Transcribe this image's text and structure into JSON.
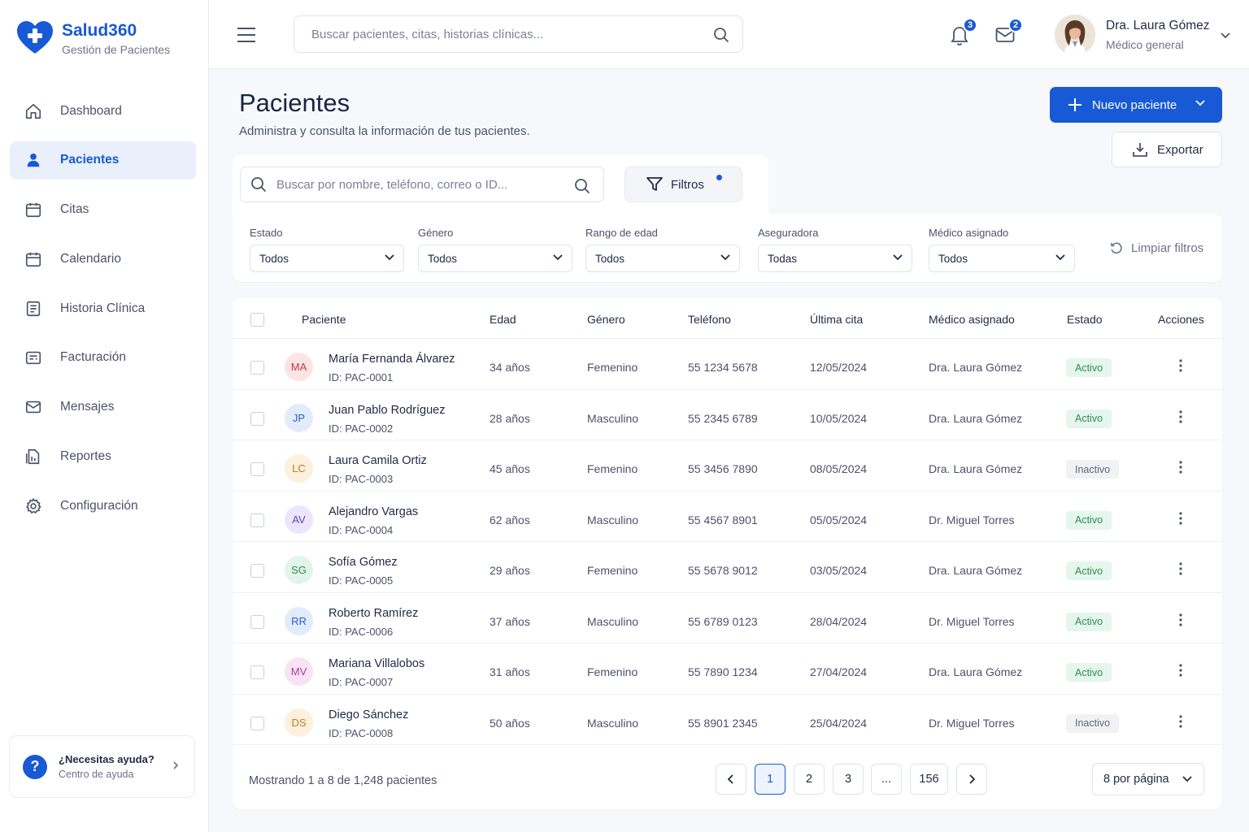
{
  "brand": {
    "name": "Salud360",
    "subtitle": "Gestión de Pacientes",
    "color": "#1859d6"
  },
  "sidebar": {
    "items": [
      {
        "label": "Dashboard",
        "icon": "home-icon",
        "active": false
      },
      {
        "label": "Pacientes",
        "icon": "user-icon",
        "active": true
      },
      {
        "label": "Citas",
        "icon": "calendar-icon",
        "active": false
      },
      {
        "label": "Calendario",
        "icon": "calendar-icon",
        "active": false
      },
      {
        "label": "Historia Clínica",
        "icon": "clipboard-icon",
        "active": false
      },
      {
        "label": "Facturación",
        "icon": "invoice-icon",
        "active": false
      },
      {
        "label": "Mensajes",
        "icon": "mail-icon",
        "active": false
      },
      {
        "label": "Reportes",
        "icon": "report-icon",
        "active": false
      },
      {
        "label": "Configuración",
        "icon": "gear-icon",
        "active": false
      }
    ],
    "help": {
      "title": "¿Necesitas ayuda?",
      "subtitle": "Centro de ayuda"
    }
  },
  "topbar": {
    "search_placeholder": "Buscar pacientes, citas, historias clínicas...",
    "notifications_count": "3",
    "messages_count": "2",
    "user": {
      "name": "Dra. Laura Gómez",
      "role": "Médico general"
    }
  },
  "page": {
    "title": "Pacientes",
    "subtitle": "Administra y consulta la información de tus pacientes.",
    "new_button": "Nuevo paciente",
    "export_button": "Exportar"
  },
  "filters": {
    "search_placeholder": "Buscar por nombre, teléfono, correo o ID...",
    "filters_button": "Filtros",
    "groups": [
      {
        "label": "Estado",
        "value": "Todos"
      },
      {
        "label": "Género",
        "value": "Todos"
      },
      {
        "label": "Rango de edad",
        "value": "Todos"
      },
      {
        "label": "Aseguradora",
        "value": "Todas"
      },
      {
        "label": "Médico asignado",
        "value": "Todos"
      }
    ],
    "clear_label": "Limpiar filtros"
  },
  "table": {
    "columns": [
      "Paciente",
      "Edad",
      "Género",
      "Teléfono",
      "Última cita",
      "Médico asignado",
      "Estado",
      "Acciones"
    ],
    "rows": [
      {
        "initials": "MA",
        "name": "María Fernanda Álvarez",
        "id": "ID: PAC-0001",
        "age": "34 años",
        "gender": "Femenino",
        "phone": "55 1234 5678",
        "last": "12/05/2024",
        "doctor": "Dra. Laura Gómez",
        "status": "Activo",
        "avatar_bg": "#fde4e4",
        "avatar_fg": "#c43b3b"
      },
      {
        "initials": "JP",
        "name": "Juan Pablo Rodríguez",
        "id": "ID: PAC-0002",
        "age": "28 años",
        "gender": "Masculino",
        "phone": "55 2345 6789",
        "last": "10/05/2024",
        "doctor": "Dra. Laura Gómez",
        "status": "Activo",
        "avatar_bg": "#e1ebfc",
        "avatar_fg": "#2a5ec4"
      },
      {
        "initials": "LC",
        "name": "Laura Camila Ortiz",
        "id": "ID: PAC-0003",
        "age": "45 años",
        "gender": "Femenino",
        "phone": "55 3456 7890",
        "last": "08/05/2024",
        "doctor": "Dra. Laura Gómez",
        "status": "Inactivo",
        "avatar_bg": "#fdf0dc",
        "avatar_fg": "#c07a1c"
      },
      {
        "initials": "AV",
        "name": "Alejandro Vargas",
        "id": "ID: PAC-0004",
        "age": "62 años",
        "gender": "Masculino",
        "phone": "55 4567 8901",
        "last": "05/05/2024",
        "doctor": "Dr. Miguel Torres",
        "status": "Activo",
        "avatar_bg": "#ebe6fb",
        "avatar_fg": "#5b46b8"
      },
      {
        "initials": "SG",
        "name": "Sofía Gómez",
        "id": "ID: PAC-0005",
        "age": "29 años",
        "gender": "Femenino",
        "phone": "55 5678 9012",
        "last": "03/05/2024",
        "doctor": "Dra. Laura Gómez",
        "status": "Activo",
        "avatar_bg": "#e1f5ea",
        "avatar_fg": "#2f8a57"
      },
      {
        "initials": "RR",
        "name": "Roberto Ramírez",
        "id": "ID: PAC-0006",
        "age": "37 años",
        "gender": "Masculino",
        "phone": "55 6789 0123",
        "last": "28/04/2024",
        "doctor": "Dr. Miguel Torres",
        "status": "Activo",
        "avatar_bg": "#e1ebfc",
        "avatar_fg": "#2a5ec4"
      },
      {
        "initials": "MV",
        "name": "Mariana Villalobos",
        "id": "ID: PAC-0007",
        "age": "31 años",
        "gender": "Femenino",
        "phone": "55 7890 1234",
        "last": "27/04/2024",
        "doctor": "Dra. Laura Gómez",
        "status": "Activo",
        "avatar_bg": "#f8e3f4",
        "avatar_fg": "#b13c9c"
      },
      {
        "initials": "DS",
        "name": "Diego Sánchez",
        "id": "ID: PAC-0008",
        "age": "50 años",
        "gender": "Masculino",
        "phone": "55 8901 2345",
        "last": "25/04/2024",
        "doctor": "Dr. Miguel Torres",
        "status": "Inactivo",
        "avatar_bg": "#fdf0dc",
        "avatar_fg": "#c07a1c"
      }
    ],
    "status_colors": {
      "Activo": {
        "bg": "#e5f6ec",
        "fg": "#2f8a57"
      },
      "Inactivo": {
        "bg": "#f1f2f5",
        "fg": "#5f677a"
      }
    }
  },
  "pagination": {
    "showing": "Mostrando 1 a 8 de 1,248 pacientes",
    "pages": [
      "1",
      "2",
      "3",
      "...",
      "156"
    ],
    "current": "1",
    "per_page": "8 por página"
  }
}
